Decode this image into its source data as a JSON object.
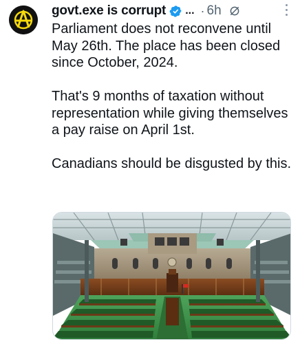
{
  "tweet": {
    "author_name": "govt.exe is corrupt",
    "ellipsis": "...",
    "separator": "·",
    "time": "6h",
    "paragraphs": [
      "Parliament does not reconvene until May 26th. The place has been closed since October, 2024.",
      "That's 9 months of taxation without representation while giving themselves a pay raise on April 1st.",
      "Canadians should be disgusted by this."
    ]
  },
  "icons": {
    "avatar": "anarchy-a-symbol",
    "verified": "verified-badge-icon",
    "status": "no-disturb-icon",
    "more": "more-vertical-icon"
  },
  "colors": {
    "verified": "#1d9bf0",
    "avatar_bg": "#111111",
    "avatar_fg": "#f5d90a",
    "secondary_text": "#536471",
    "carpet": "#3e9b4a",
    "roof": "#9cc6b6"
  }
}
